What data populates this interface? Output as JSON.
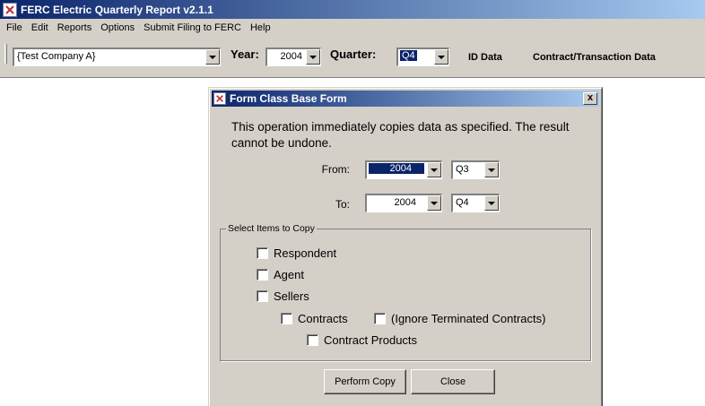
{
  "app": {
    "title": "FERC Electric Quarterly Report v2.1.1",
    "menu": [
      "File",
      "Edit",
      "Reports",
      "Options",
      "Submit Filing to FERC",
      "Help"
    ]
  },
  "toolbar": {
    "company": "{Test Company A}",
    "year_label": "Year:",
    "year_value": "2004",
    "quarter_label": "Quarter:",
    "quarter_value": "Q4",
    "id_data": "ID Data",
    "contract_data": "Contract/Transaction Data"
  },
  "dialog": {
    "title": "Form Class Base Form",
    "close": "x",
    "message": "This operation immediately copies data as specified. The result cannot be undone.",
    "from_label": "From:",
    "from_year": "2004",
    "from_quarter": "Q3",
    "to_label": "To:",
    "to_year": "2004",
    "to_quarter": "Q4",
    "group_label": "Select Items to Copy",
    "items": {
      "respondent": "Respondent",
      "agent": "Agent",
      "sellers": "Sellers",
      "contracts": "Contracts",
      "ignore_terminated": "(Ignore Terminated Contracts)",
      "contract_products": "Contract Products"
    },
    "perform_copy": "Perform Copy",
    "close_button": "Close"
  },
  "colors": {
    "titlebar_start": "#0a246a",
    "titlebar_end": "#a6caf0",
    "window_face": "#d4d0c8",
    "selection": "#0a246a"
  }
}
